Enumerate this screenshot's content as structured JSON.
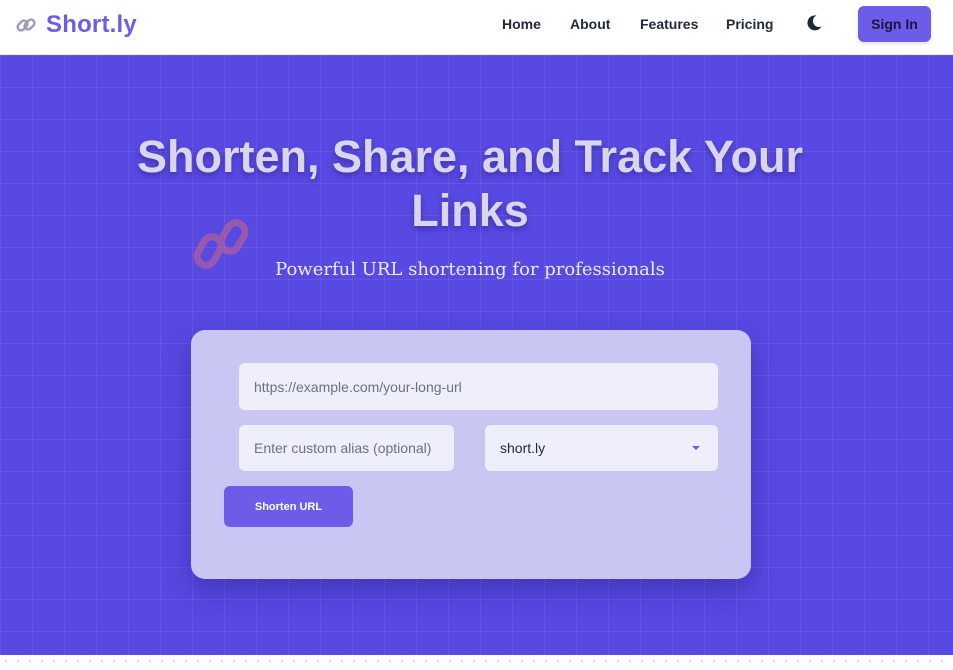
{
  "header": {
    "brand": "Short.ly",
    "brand_icon": "link-icon",
    "nav": [
      {
        "label": "Home"
      },
      {
        "label": "About"
      },
      {
        "label": "Features"
      },
      {
        "label": "Pricing"
      }
    ],
    "theme_toggle_icon": "moon-icon",
    "signin_label": "Sign In"
  },
  "hero": {
    "title": "Shorten, Share, and Track Your Links",
    "subtitle": "Powerful URL shortening for professionals",
    "decoration_icon": "link-icon"
  },
  "form": {
    "url_placeholder": "https://example.com/your-long-url",
    "url_value": "",
    "alias_placeholder": "Enter custom alias (optional)",
    "alias_value": "",
    "domain_selected": "short.ly",
    "submit_label": "Shorten URL"
  },
  "colors": {
    "brand": "#6c5ce7",
    "hero_background": "#5749e2",
    "card_background": "#c9c6f3"
  }
}
